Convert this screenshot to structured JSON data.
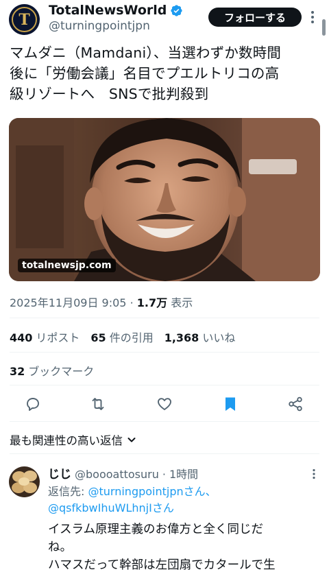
{
  "author": {
    "name": "TotalNewsWorld",
    "handle": "@turningpointjpn",
    "avatar_letter": "T",
    "verified": true
  },
  "follow_label": "フォローする",
  "post": {
    "text": "マムダニ（Mamdani）、当選わずか数時間\n後に「労働会議」名目でプエルトリコの高\n級リゾートへ　SNSで批判殺到",
    "image_watermark": "totalnewsjp.com",
    "timestamp": "2025年11月09日 9:05",
    "dot": "·",
    "views_count": "1.7万",
    "views_label": "表示"
  },
  "stats": {
    "reposts_count": "440",
    "reposts_label": "リポスト",
    "quotes_count": "65",
    "quotes_label": "件の引用",
    "likes_count": "1,368",
    "likes_label": "いいね",
    "bookmarks_count": "32",
    "bookmarks_label": "ブックマーク"
  },
  "actions": [
    "reply-icon",
    "repost-icon",
    "like-icon",
    "bookmark-icon",
    "share-icon"
  ],
  "colors": {
    "accent": "#1d9bf0",
    "text": "#0f1419",
    "muted": "#536471",
    "divider": "#eff3f4"
  },
  "sort_label": "最も関連性の高い返信",
  "reply": {
    "name": "じじ",
    "handle": "@boooattosuru",
    "dot": "·",
    "time": "1時間",
    "to_prefix": "返信先:",
    "to_user1": "@turningpointjpnさん、",
    "to_user2": "@qsfkbwIhuWLhnjIさん",
    "text": "イスラム原理主義のお偉方と全く同じだ\nね。\nハマスだって幹部は左団扇でカタールで生"
  }
}
